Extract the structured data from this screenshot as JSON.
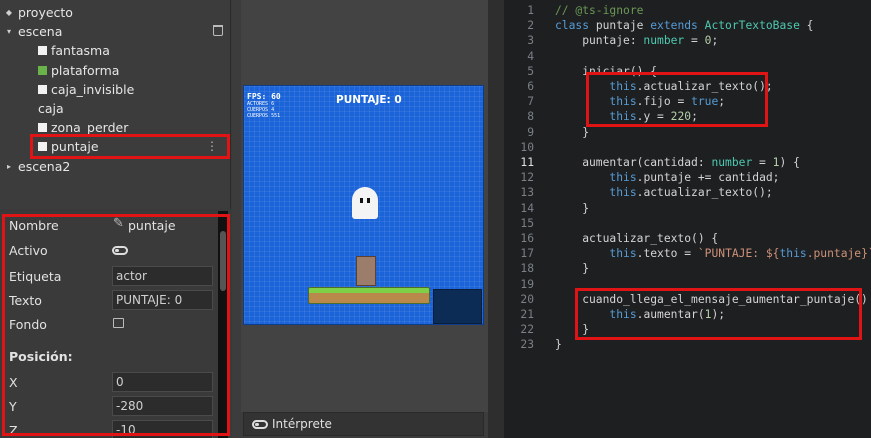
{
  "tree": {
    "project": "proyecto",
    "scene": "escena",
    "actors": [
      "fantasma",
      "plataforma",
      "caja_invisible",
      "caja",
      "zona_perder",
      "puntaje"
    ],
    "scene2": "escena2"
  },
  "props": {
    "name_label": "Nombre",
    "name_value": "puntaje",
    "active_label": "Activo",
    "tag_label": "Etiqueta",
    "tag_value": "actor",
    "text_label": "Texto",
    "text_value": "PUNTAJE: 0",
    "bg_label": "Fondo",
    "position_heading": "Posición:",
    "x_label": "X",
    "x_value": "0",
    "y_label": "Y",
    "y_value": "-280",
    "z_label": "Z",
    "z_value": "-10"
  },
  "stage": {
    "fps": "FPS: 60",
    "stats": [
      "ACTORES 6",
      "CUERPOS 4",
      "CUERPOS 551"
    ],
    "score": "PUNTAJE: 0"
  },
  "interpreter_label": "Intérprete",
  "code": {
    "lines": [
      {
        "n": "1",
        "segments": [
          {
            "c": "cmt",
            "t": "// @ts-ignore"
          }
        ]
      },
      {
        "n": "2",
        "segments": [
          {
            "c": "kw",
            "t": "class "
          },
          {
            "c": "",
            "t": "puntaje "
          },
          {
            "c": "kw",
            "t": "extends "
          },
          {
            "c": "cls",
            "t": "ActorTextoBase"
          },
          {
            "c": "",
            "t": " {"
          }
        ]
      },
      {
        "n": "3",
        "segments": [
          {
            "c": "",
            "t": "    puntaje: "
          },
          {
            "c": "typ",
            "t": "number"
          },
          {
            "c": "",
            "t": " = "
          },
          {
            "c": "nm",
            "t": "0"
          },
          {
            "c": "",
            "t": ";"
          }
        ]
      },
      {
        "n": "4",
        "segments": []
      },
      {
        "n": "5",
        "segments": [
          {
            "c": "",
            "t": "    iniciar() {"
          }
        ]
      },
      {
        "n": "6",
        "segments": [
          {
            "c": "",
            "t": "        "
          },
          {
            "c": "th",
            "t": "this"
          },
          {
            "c": "",
            "t": ".actualizar_texto();"
          }
        ]
      },
      {
        "n": "7",
        "segments": [
          {
            "c": "",
            "t": "        "
          },
          {
            "c": "th",
            "t": "this"
          },
          {
            "c": "",
            "t": ".fijo = "
          },
          {
            "c": "kw",
            "t": "true"
          },
          {
            "c": "",
            "t": ";"
          }
        ]
      },
      {
        "n": "8",
        "segments": [
          {
            "c": "",
            "t": "        "
          },
          {
            "c": "th",
            "t": "this"
          },
          {
            "c": "",
            "t": ".y = "
          },
          {
            "c": "nm",
            "t": "220"
          },
          {
            "c": "",
            "t": ";"
          }
        ]
      },
      {
        "n": "9",
        "segments": [
          {
            "c": "",
            "t": "    }"
          }
        ]
      },
      {
        "n": "10",
        "segments": []
      },
      {
        "n": "11",
        "segments": [
          {
            "c": "",
            "t": "    aumentar(cantidad: "
          },
          {
            "c": "typ",
            "t": "number"
          },
          {
            "c": "",
            "t": " = "
          },
          {
            "c": "nm",
            "t": "1"
          },
          {
            "c": "",
            "t": ") {"
          }
        ]
      },
      {
        "n": "12",
        "segments": [
          {
            "c": "",
            "t": "        "
          },
          {
            "c": "th",
            "t": "this"
          },
          {
            "c": "",
            "t": ".puntaje += cantidad;"
          }
        ]
      },
      {
        "n": "13",
        "segments": [
          {
            "c": "",
            "t": "        "
          },
          {
            "c": "th",
            "t": "this"
          },
          {
            "c": "",
            "t": ".actualizar_texto();"
          }
        ]
      },
      {
        "n": "14",
        "segments": [
          {
            "c": "",
            "t": "    }"
          }
        ]
      },
      {
        "n": "15",
        "segments": []
      },
      {
        "n": "16",
        "segments": [
          {
            "c": "",
            "t": "    actualizar_texto() {"
          }
        ]
      },
      {
        "n": "17",
        "segments": [
          {
            "c": "",
            "t": "        "
          },
          {
            "c": "th",
            "t": "this"
          },
          {
            "c": "",
            "t": ".texto = "
          },
          {
            "c": "str",
            "t": "`PUNTAJE: ${"
          },
          {
            "c": "th",
            "t": "this"
          },
          {
            "c": "str",
            "t": ".puntaje}`"
          },
          {
            "c": "",
            "t": ";"
          }
        ]
      },
      {
        "n": "18",
        "segments": [
          {
            "c": "",
            "t": "    }"
          }
        ]
      },
      {
        "n": "19",
        "segments": []
      },
      {
        "n": "20",
        "segments": [
          {
            "c": "",
            "t": "    cuando_llega_el_mensaje_aumentar_puntaje() {"
          }
        ]
      },
      {
        "n": "21",
        "segments": [
          {
            "c": "",
            "t": "        "
          },
          {
            "c": "th",
            "t": "this"
          },
          {
            "c": "",
            "t": ".aumentar("
          },
          {
            "c": "nm",
            "t": "1"
          },
          {
            "c": "",
            "t": ");"
          }
        ]
      },
      {
        "n": "22",
        "segments": [
          {
            "c": "",
            "t": "    }"
          }
        ]
      },
      {
        "n": "23",
        "segments": [
          {
            "c": "",
            "t": "}"
          }
        ]
      }
    ],
    "active_line": "11"
  },
  "colors": {
    "highlight": "#e01414",
    "stage_bg": "#1a63d8",
    "editor_bg": "#1e1f21"
  }
}
